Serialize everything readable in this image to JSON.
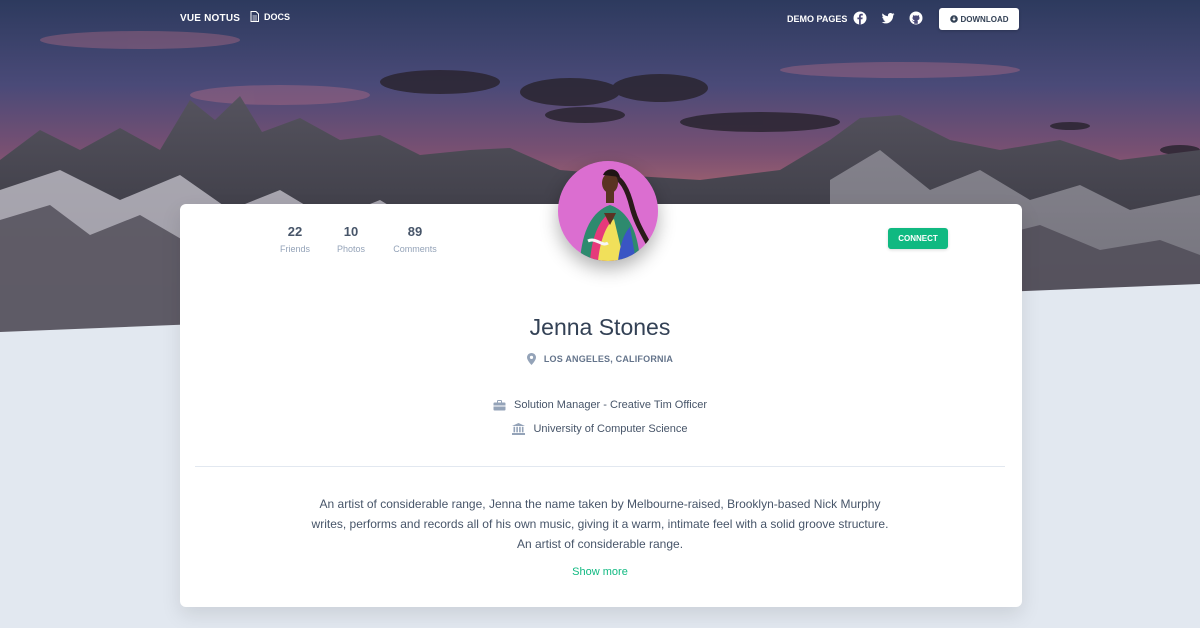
{
  "nav": {
    "brand": "VUE NOTUS",
    "docs_label": "DOCS",
    "demo_pages_label": "DEMO PAGES",
    "download_label": "DOWNLOAD",
    "social_icons": [
      "facebook-icon",
      "twitter-icon",
      "github-icon"
    ]
  },
  "profile": {
    "stats": [
      {
        "value": "22",
        "label": "Friends"
      },
      {
        "value": "10",
        "label": "Photos"
      },
      {
        "value": "89",
        "label": "Comments"
      }
    ],
    "connect_label": "CONNECT",
    "name": "Jenna Stones",
    "location": "LOS ANGELES, CALIFORNIA",
    "job": "Solution Manager - Creative Tim Officer",
    "education": "University of Computer Science",
    "bio_lines": [
      "An artist of considerable range, Jenna the name taken by Melbourne-raised, Brooklyn-based Nick Murphy",
      "writes, performs and records all of his own music, giving it a warm, intimate feel with a solid groove structure.",
      "An artist of considerable range."
    ],
    "show_more_label": "Show more"
  },
  "colors": {
    "accent": "#10b981",
    "background": "#e2e8f0",
    "text_dark": "#334155"
  }
}
